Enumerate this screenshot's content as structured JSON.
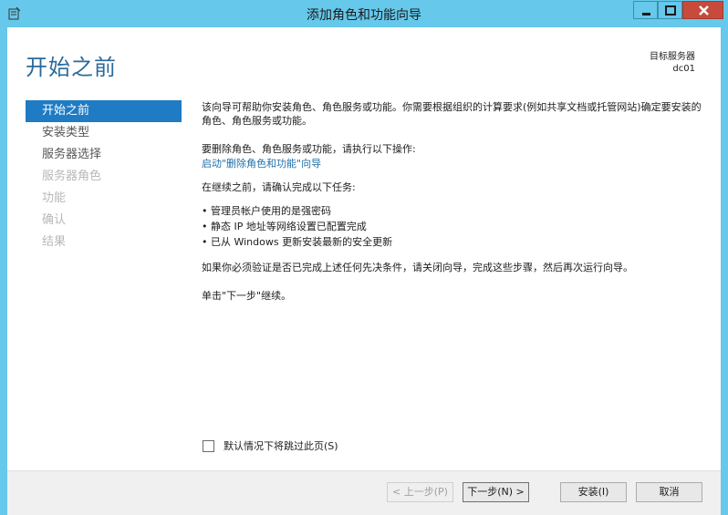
{
  "window": {
    "title": "添加角色和功能向导"
  },
  "header": {
    "page_title": "开始之前",
    "target_label": "目标服务器",
    "target_server": "dc01"
  },
  "nav": {
    "items": [
      {
        "label": "开始之前",
        "state": "active"
      },
      {
        "label": "安装类型",
        "state": "enabled"
      },
      {
        "label": "服务器选择",
        "state": "enabled"
      },
      {
        "label": "服务器角色",
        "state": "disabled"
      },
      {
        "label": "功能",
        "state": "disabled"
      },
      {
        "label": "确认",
        "state": "disabled"
      },
      {
        "label": "结果",
        "state": "disabled"
      }
    ]
  },
  "main": {
    "intro": "该向导可帮助你安装角色、角色服务或功能。你需要根据组织的计算要求(例如共享文档或托管网站)确定要安装的角色、角色服务或功能。",
    "remove_text": "要删除角色、角色服务或功能，请执行以下操作:",
    "remove_link": "启动\"删除角色和功能\"向导",
    "confirm_text": "在继续之前，请确认完成以下任务:",
    "tasks": [
      "• 管理员帐户使用的是强密码",
      "• 静态 IP 地址等网络设置已配置完成",
      "• 已从 Windows 更新安装最新的安全更新"
    ],
    "verify_text": "如果你必须验证是否已完成上述任何先决条件，请关闭向导，完成这些步骤，然后再次运行向导。",
    "click_next": "单击\"下一步\"继续。"
  },
  "skip_checkbox": {
    "label": "默认情况下将跳过此页(S)",
    "checked": false
  },
  "buttons": {
    "prev": "< 上一步(P)",
    "next": "下一步(N) >",
    "install": "安装(I)",
    "cancel": "取消"
  },
  "colors": {
    "titlebar": "#66c8ea",
    "accent": "#1e7bc4",
    "page_title": "#2a6a9a",
    "link": "#1f6fa8",
    "close_button": "#c74a3a"
  }
}
